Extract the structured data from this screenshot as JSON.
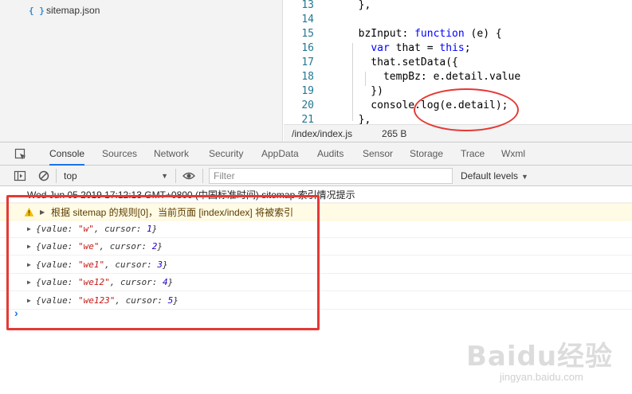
{
  "file_tree": {
    "items": [
      {
        "icon": "json-file-icon",
        "icon_glyph": "{ }",
        "label": "sitemap.json"
      }
    ]
  },
  "editor": {
    "lines": [
      {
        "n": "13",
        "code": "  },"
      },
      {
        "n": "14",
        "code": ""
      },
      {
        "n": "15",
        "code": "  bzInput: function (e) {"
      },
      {
        "n": "16",
        "code": "    var that = this;"
      },
      {
        "n": "17",
        "code": "    that.setData({"
      },
      {
        "n": "18",
        "code": "      tempBz: e.detail.value"
      },
      {
        "n": "19",
        "code": "    })"
      },
      {
        "n": "20",
        "code": "    console.log(e.detail);"
      },
      {
        "n": "21",
        "code": "  },"
      }
    ],
    "status_path": "/index/index.js",
    "status_size": "265 B"
  },
  "tabs": [
    "Console",
    "Sources",
    "Network",
    "Security",
    "AppData",
    "Audits",
    "Sensor",
    "Storage",
    "Trace",
    "Wxml"
  ],
  "active_tab": "Console",
  "toolbar": {
    "context": "top",
    "filter_placeholder": "Filter",
    "levels": "Default levels"
  },
  "console": {
    "date_line": "Wed Jun 05 2019 17:12:13 GMT+0800 (中国标准时间) sitemap 索引情况提示",
    "warning": "根据 sitemap 的规则[0]，当前页面 [index/index] 将被索引",
    "objects": [
      {
        "value": "w",
        "cursor": "1"
      },
      {
        "value": "we",
        "cursor": "2"
      },
      {
        "value": "we1",
        "cursor": "3"
      },
      {
        "value": "we12",
        "cursor": "4"
      },
      {
        "value": "we123",
        "cursor": "5"
      }
    ],
    "prompt": "›"
  },
  "watermark": {
    "mark": "Baidu经验",
    "sub": "jingyan.baidu.com"
  },
  "colors": {
    "annotation": "#e53935",
    "accent": "#1a73e8",
    "keyword": "#0000ff",
    "string": "#c41a16",
    "number": "#1c00cf"
  }
}
